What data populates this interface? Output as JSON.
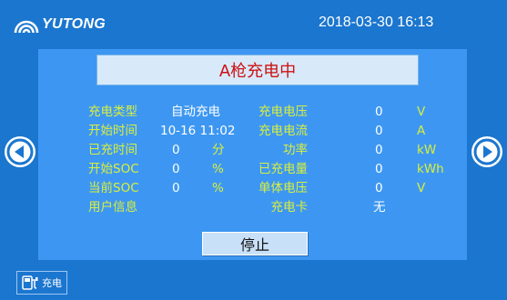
{
  "header": {
    "logo_text": "YUTONG",
    "datetime": "2018-03-30 16:13"
  },
  "status": {
    "title": "A枪充电中"
  },
  "left_fields": [
    {
      "label": "充电类型",
      "value": "自动充电",
      "unit": ""
    },
    {
      "label": "开始时间",
      "value": "10-16 11:02",
      "unit": ""
    },
    {
      "label": "已充时间",
      "value": "0",
      "unit": "分"
    },
    {
      "label": "开始SOC",
      "value": "0",
      "unit": "%"
    },
    {
      "label": "当前SOC",
      "value": "0",
      "unit": "%"
    },
    {
      "label": "用户信息",
      "value": "",
      "unit": ""
    }
  ],
  "right_fields": [
    {
      "label": "充电电压",
      "value": "0",
      "unit": "V"
    },
    {
      "label": "充电电流",
      "value": "0",
      "unit": "A"
    },
    {
      "label": "功率",
      "value": "0",
      "unit": "kW"
    },
    {
      "label": "已充电量",
      "value": "0",
      "unit": "kWh"
    },
    {
      "label": "单体电压",
      "value": "0",
      "unit": "V"
    },
    {
      "label": "充电卡",
      "value": "无",
      "unit": ""
    }
  ],
  "actions": {
    "stop_label": "停止"
  },
  "bottom_tab": {
    "label": "充电",
    "icon": "charger-icon"
  },
  "nav": {
    "prev_icon": "arrow-left-icon",
    "next_icon": "arrow-right-icon"
  },
  "colors": {
    "background": "#1b76cf",
    "panel": "#3d97f2",
    "label": "#d9ef3c",
    "status_text": "#cc1111"
  }
}
